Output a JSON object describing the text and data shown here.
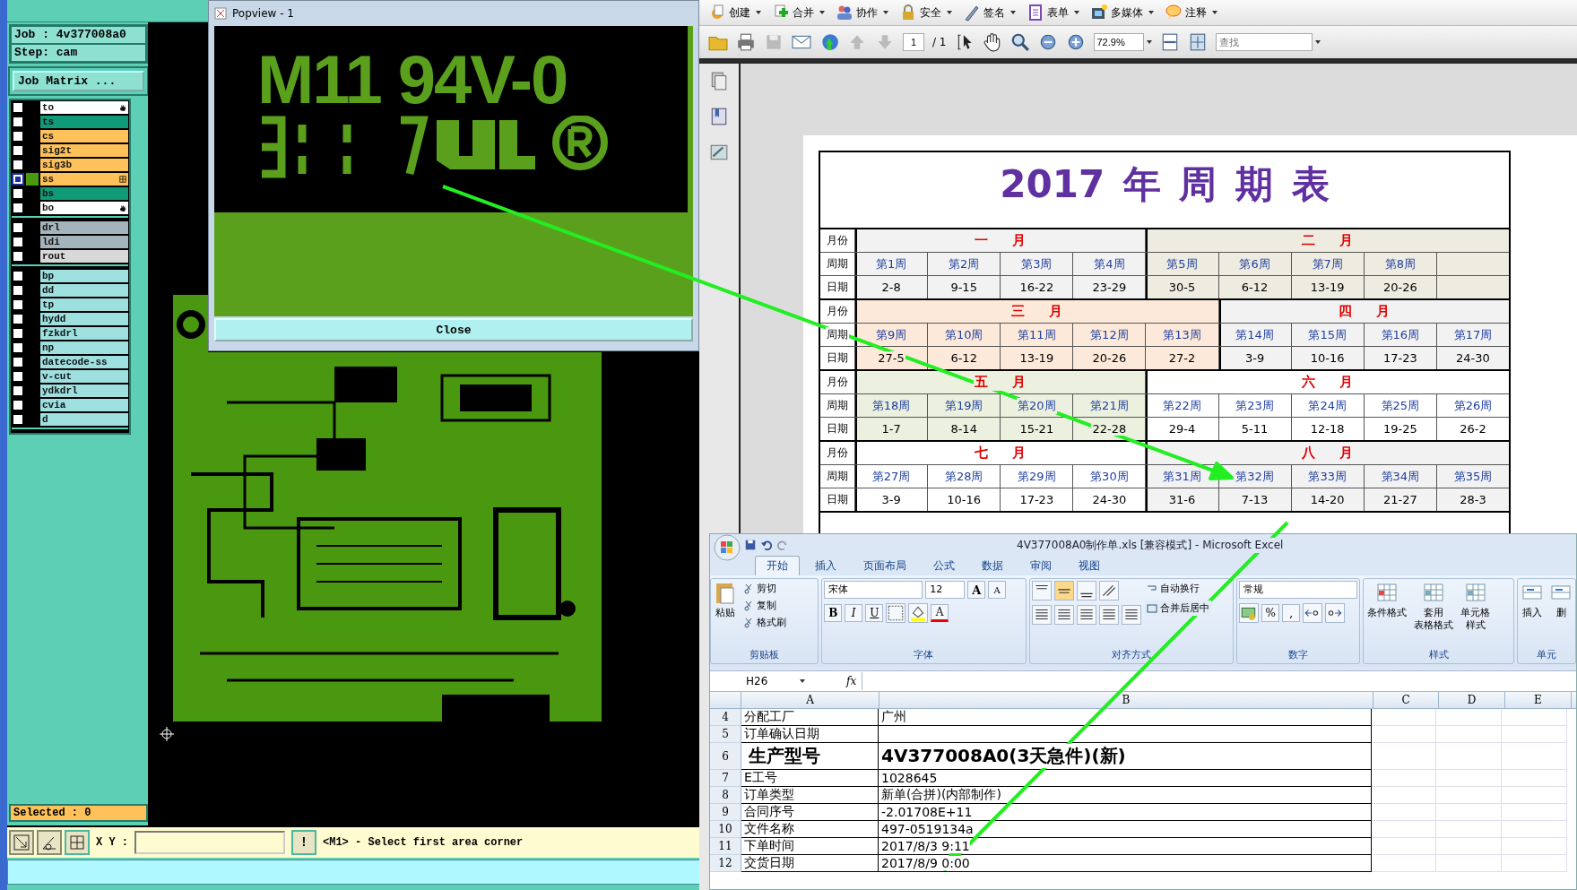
{
  "cam": {
    "job": "Job : 4v377008a0",
    "step": "Step: cam",
    "matrix_button": "Job Matrix ...",
    "layer_groups": [
      {
        "layers": [
          {
            "name": "to",
            "color": "#ffffff",
            "displayed": false,
            "kind": "hand"
          },
          {
            "name": "ts",
            "color": "#0f9a78",
            "displayed": false,
            "kind": "plain"
          },
          {
            "name": "cs",
            "color": "#ffc25a",
            "displayed": false,
            "kind": "plain"
          },
          {
            "name": "sig2t",
            "color": "#ffc25a",
            "displayed": false,
            "kind": "plain"
          },
          {
            "name": "sig3b",
            "color": "#ffc25a",
            "displayed": false,
            "kind": "plain"
          },
          {
            "name": "ss",
            "color": "#ffc25a",
            "displayed": true,
            "kind": "grid"
          },
          {
            "name": "bs",
            "color": "#0f9a78",
            "displayed": false,
            "kind": "plain"
          },
          {
            "name": "bo",
            "color": "#ffffff",
            "displayed": false,
            "kind": "hand"
          }
        ]
      },
      {
        "layers": [
          {
            "name": "drl",
            "color": "#a4b4bc",
            "displayed": false
          },
          {
            "name": "ldi",
            "color": "#a4b4bc",
            "displayed": false
          },
          {
            "name": "rout",
            "color": "#d8d8d8",
            "displayed": false
          }
        ]
      },
      {
        "layers": [
          {
            "name": "bp",
            "color": "#9ee0e0",
            "displayed": false
          },
          {
            "name": "dd",
            "color": "#9ee0e0",
            "displayed": false
          },
          {
            "name": "tp",
            "color": "#9ee0e0",
            "displayed": false
          },
          {
            "name": "hydd",
            "color": "#9ee0e0",
            "displayed": false
          },
          {
            "name": "fzkdrl",
            "color": "#9ee0e0",
            "displayed": false
          },
          {
            "name": "np",
            "color": "#9ee0e0",
            "displayed": false
          },
          {
            "name": "datecode-ss",
            "color": "#9ee0e0",
            "displayed": false
          },
          {
            "name": "v-cut",
            "color": "#9ee0e0",
            "displayed": false
          },
          {
            "name": "ydkdrl",
            "color": "#9ee0e0",
            "displayed": false
          },
          {
            "name": "cvia",
            "color": "#9ee0e0",
            "displayed": false
          },
          {
            "name": "d",
            "color": "#9ee0e0",
            "displayed": false
          }
        ]
      }
    ],
    "selected_count": "Selected : 0",
    "coord_label": "X Y :",
    "alert_button": "!",
    "message": "<M1> - Select first area corner"
  },
  "popview": {
    "title": "Popview - 1",
    "marking": "M11 94V-0",
    "close_button": "Close"
  },
  "pdf": {
    "menu": [
      "创建",
      "合并",
      "协作",
      "安全",
      "签名",
      "表单",
      "多媒体",
      "注释"
    ],
    "page_field": "1",
    "page_total": "/ 1",
    "zoom": "72.9%",
    "search_placeholder": "查找",
    "calendar": {
      "title": "2017 年 周 期 表",
      "blocks": [
        {
          "labels": [
            "月份",
            "周期",
            "日期"
          ],
          "months": [
            {
              "name": "一 月",
              "color": "#f2f2f2",
              "weeks": [
                {
                  "week": "第1周",
                  "dates": "2-8"
                },
                {
                  "week": "第2周",
                  "dates": "9-15"
                },
                {
                  "week": "第3周",
                  "dates": "16-22"
                },
                {
                  "week": "第4周",
                  "dates": "23-29"
                }
              ]
            },
            {
              "name": "二 月",
              "color": "#eeece1",
              "weeks": [
                {
                  "week": "第5周",
                  "dates": "30-5"
                },
                {
                  "week": "第6周",
                  "dates": "6-12"
                },
                {
                  "week": "第7周",
                  "dates": "13-19"
                },
                {
                  "week": "第8周",
                  "dates": "20-26"
                }
              ]
            }
          ]
        },
        {
          "labels": [
            "月份",
            "周期",
            "日期"
          ],
          "months": [
            {
              "name": "三 月",
              "color": "#fde9d9",
              "weeks": [
                {
                  "week": "第9周",
                  "dates": "27-5"
                },
                {
                  "week": "第10周",
                  "dates": "6-12"
                },
                {
                  "week": "第11周",
                  "dates": "13-19"
                },
                {
                  "week": "第12周",
                  "dates": "20-26"
                },
                {
                  "week": "第13周",
                  "dates": "27-2"
                }
              ]
            },
            {
              "name": "四 月",
              "color": "#f2f2f2",
              "weeks": [
                {
                  "week": "第14周",
                  "dates": "3-9"
                },
                {
                  "week": "第15周",
                  "dates": "10-16"
                },
                {
                  "week": "第16周",
                  "dates": "17-23"
                },
                {
                  "week": "第17周",
                  "dates": "24-30"
                }
              ]
            }
          ]
        },
        {
          "labels": [
            "月份",
            "周期",
            "日期"
          ],
          "months": [
            {
              "name": "五 月",
              "color": "#ebf1de",
              "weeks": [
                {
                  "week": "第18周",
                  "dates": "1-7"
                },
                {
                  "week": "第19周",
                  "dates": "8-14"
                },
                {
                  "week": "第20周",
                  "dates": "15-21"
                },
                {
                  "week": "第21周",
                  "dates": "22-28"
                }
              ]
            },
            {
              "name": "六 月",
              "color": "#ffffff",
              "weeks": [
                {
                  "week": "第22周",
                  "dates": "29-4"
                },
                {
                  "week": "第23周",
                  "dates": "5-11"
                },
                {
                  "week": "第24周",
                  "dates": "12-18"
                },
                {
                  "week": "第25周",
                  "dates": "19-25"
                },
                {
                  "week": "第26周",
                  "dates": "26-2"
                }
              ]
            }
          ]
        },
        {
          "labels": [
            "月份",
            "周期",
            "日期"
          ],
          "months": [
            {
              "name": "七 月",
              "color": "#ffffff",
              "weeks": [
                {
                  "week": "第27周",
                  "dates": "3-9"
                },
                {
                  "week": "第28周",
                  "dates": "10-16"
                },
                {
                  "week": "第29周",
                  "dates": "17-23"
                },
                {
                  "week": "第30周",
                  "dates": "24-30"
                }
              ]
            },
            {
              "name": "八 月",
              "color": "#f2f2f2",
              "weeks": [
                {
                  "week": "第31周",
                  "dates": "31-6"
                },
                {
                  "week": "第32周",
                  "dates": "7-13"
                },
                {
                  "week": "第33周",
                  "dates": "14-20"
                },
                {
                  "week": "第34周",
                  "dates": "21-27"
                },
                {
                  "week": "第35周",
                  "dates": "28-3"
                }
              ]
            }
          ]
        }
      ]
    }
  },
  "excel": {
    "title": "4V377008A0制作单.xls  [兼容模式] - Microsoft Excel",
    "tabs": [
      {
        "label": "开始",
        "selected": true
      },
      {
        "label": "插入",
        "selected": false
      },
      {
        "label": "页面布局",
        "selected": false
      },
      {
        "label": "公式",
        "selected": false
      },
      {
        "label": "数据",
        "selected": false
      },
      {
        "label": "审阅",
        "selected": false
      },
      {
        "label": "视图",
        "selected": false
      }
    ],
    "ribbon": {
      "clipboard": {
        "label": "剪贴板",
        "paste": "粘贴",
        "tools": [
          "剪切",
          "复制",
          "格式刷"
        ]
      },
      "font": {
        "label": "字体",
        "name": "宋体",
        "size": "12",
        "size_buttons": [
          "A",
          "A"
        ],
        "styles": [
          "B",
          "I",
          "U"
        ],
        "color_button": "A"
      },
      "alignment": {
        "label": "对齐方式",
        "wrap": "自动换行",
        "merge": "合并后居中"
      },
      "number": {
        "label": "数字",
        "format": "常规",
        "symbols": [
          "%",
          ","
        ]
      },
      "styles": {
        "label": "样式",
        "items": [
          [
            "条件格式"
          ],
          [
            "套用",
            "表格格式"
          ],
          [
            "单元格",
            "样式"
          ]
        ]
      },
      "cells": {
        "label": "单元",
        "items": [
          "插入",
          "删"
        ]
      }
    },
    "name_box": "H26",
    "fx": "fx",
    "columns": [
      "A",
      "B",
      "C",
      "D",
      "E"
    ],
    "rows": [
      {
        "num": "4",
        "kind": "normal",
        "a": "分配工厂",
        "b": "广州"
      },
      {
        "num": "5",
        "kind": "normal",
        "a": "订单确认日期"
      },
      {
        "num": "6",
        "kind": "heading",
        "a": "生产型号",
        "b": "4V377008A0(3天急件)(新)"
      },
      {
        "num": "7",
        "kind": "normal",
        "a": "E工号",
        "b": "1028645"
      },
      {
        "num": "8",
        "kind": "normal",
        "a": "订单类型",
        "b": "新单(合拼)(内部制作)"
      },
      {
        "num": "9",
        "kind": "normal",
        "a": "合同序号",
        "b": "-2.01708E+11"
      },
      {
        "num": "10",
        "kind": "normal",
        "a": "文件名称",
        "b": "497-0519134a"
      },
      {
        "num": "11",
        "kind": "normal",
        "a": "下单时间",
        "b": "2017/8/3 9:11"
      },
      {
        "num": "12",
        "kind": "normal",
        "a": "交货日期",
        "b": "2017/8/9 0:00"
      }
    ]
  }
}
